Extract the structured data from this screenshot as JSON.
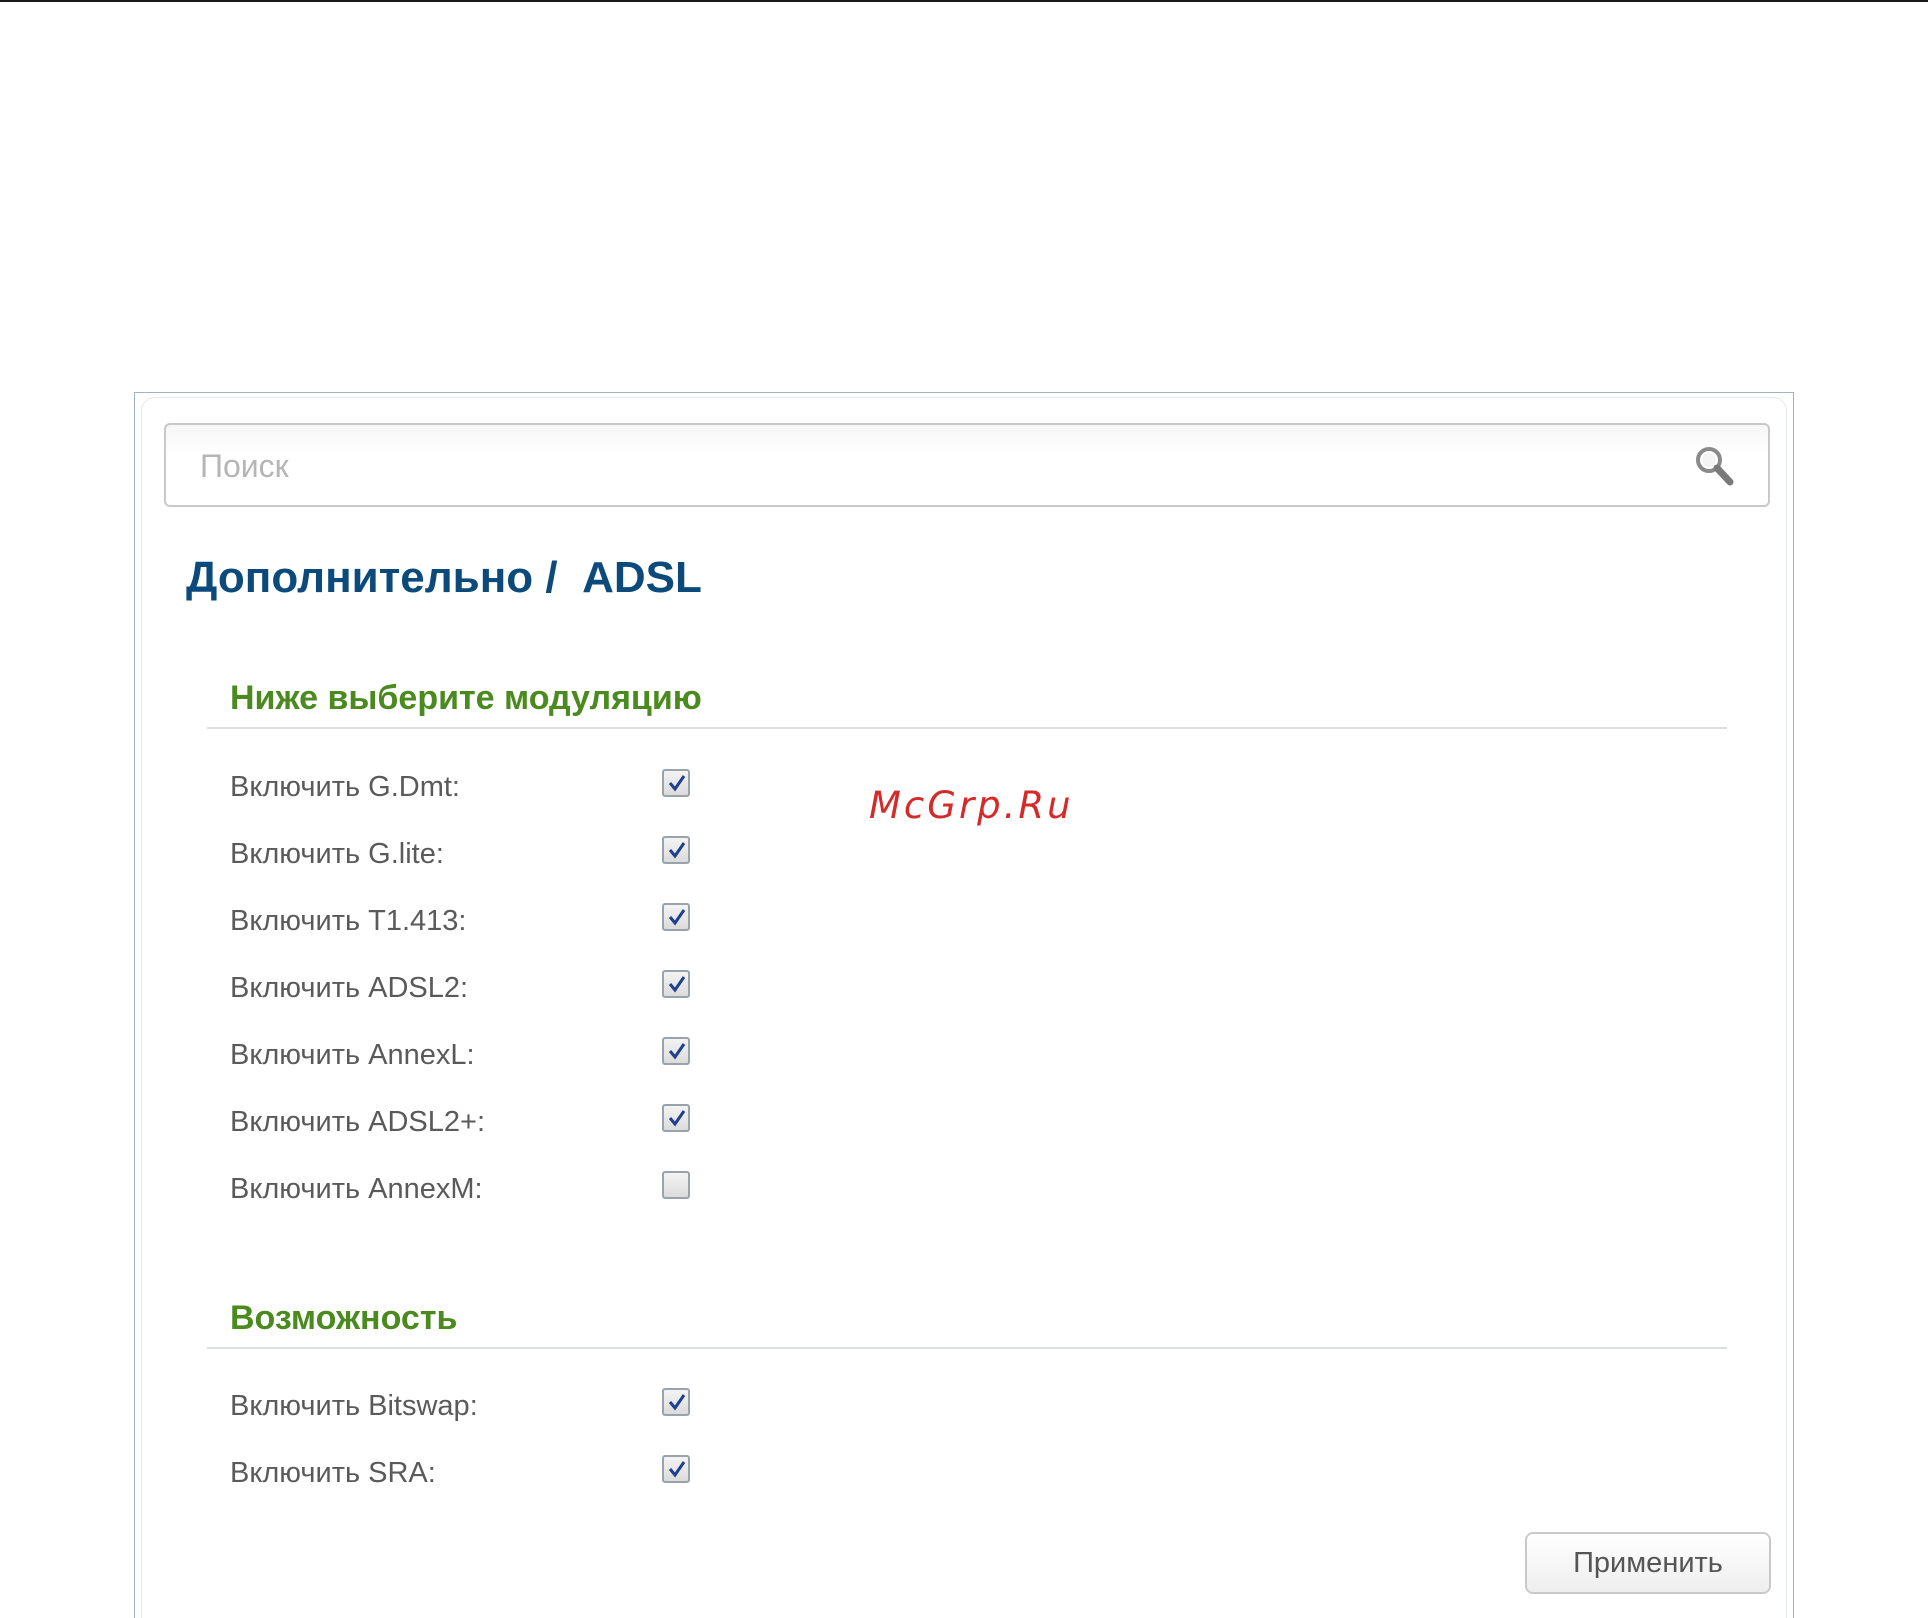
{
  "search": {
    "placeholder": "Поиск",
    "icon": "search-icon"
  },
  "breadcrumb": {
    "parent": "Дополнительно /",
    "current": "ADSL"
  },
  "modulation": {
    "title": "Ниже выберите модуляцию",
    "items": [
      {
        "label": "Включить G.Dmt:",
        "checked": true
      },
      {
        "label": "Включить G.lite:",
        "checked": true
      },
      {
        "label": "Включить T1.413:",
        "checked": true
      },
      {
        "label": "Включить ADSL2:",
        "checked": true
      },
      {
        "label": "Включить AnnexL:",
        "checked": true
      },
      {
        "label": "Включить ADSL2+:",
        "checked": true
      },
      {
        "label": "Включить AnnexM:",
        "checked": false
      }
    ]
  },
  "capability": {
    "title": "Возможность",
    "items": [
      {
        "label": "Включить Bitswap:",
        "checked": true
      },
      {
        "label": "Включить SRA:",
        "checked": true
      }
    ]
  },
  "actions": {
    "apply_label": "Применить"
  },
  "watermark": "McGrp.Ru",
  "colors": {
    "title": "#0c4a7c",
    "section_heading": "#4b8a1f",
    "checkmark": "#1f3f8f",
    "watermark": "#d42a2a"
  }
}
